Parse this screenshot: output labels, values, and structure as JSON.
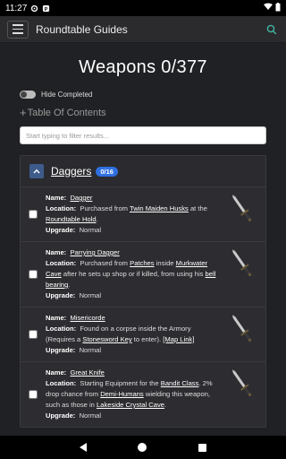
{
  "status_bar": {
    "time": "11:27"
  },
  "app_bar": {
    "title": "Roundtable Guides"
  },
  "page": {
    "title": "Weapons 0/377",
    "hide_completed_label": "Hide Completed",
    "toc_label": "Table Of Contents",
    "filter_placeholder": "Start typing to filter results..."
  },
  "section": {
    "title": "Daggers",
    "count": "0/16",
    "items": [
      {
        "name_label": "Name:",
        "name": "Dagger",
        "location_label": "Location:",
        "location": [
          {
            "t": "Purchased from "
          },
          {
            "t": "Twin Maiden Husks",
            "u": true
          },
          {
            "t": " at the "
          },
          {
            "t": "Roundtable Hold",
            "u": true
          },
          {
            "t": "."
          }
        ],
        "upgrade_label": "Upgrade:",
        "upgrade": "Normal"
      },
      {
        "name_label": "Name:",
        "name": "Parrying Dagger",
        "location_label": "Location:",
        "location": [
          {
            "t": "Purchased from "
          },
          {
            "t": "Patches",
            "u": true
          },
          {
            "t": " inside "
          },
          {
            "t": "Murkwater Cave",
            "u": true
          },
          {
            "t": " after he sets up shop or if killed, from using his "
          },
          {
            "t": "bell bearing",
            "u": true
          },
          {
            "t": "."
          }
        ],
        "upgrade_label": "Upgrade:",
        "upgrade": "Normal"
      },
      {
        "name_label": "Name:",
        "name": "Misericorde",
        "location_label": "Location:",
        "location": [
          {
            "t": "Found on a corpse inside the Armory (Requires a "
          },
          {
            "t": "Stonesword Key",
            "u": true
          },
          {
            "t": " to enter). "
          },
          {
            "t": "[Map Link]",
            "u": true
          }
        ],
        "upgrade_label": "Upgrade:",
        "upgrade": "Normal"
      },
      {
        "name_label": "Name:",
        "name": "Great Knife",
        "location_label": "Location:",
        "location": [
          {
            "t": "Starting Equipment for the "
          },
          {
            "t": "Bandit Class",
            "u": true
          },
          {
            "t": ". 2% drop chance from "
          },
          {
            "t": "Demi-Humans",
            "u": true
          },
          {
            "t": " wielding this weapon, such as those in "
          },
          {
            "t": "Lakeside Crystal Cave",
            "u": true
          },
          {
            "t": "."
          }
        ],
        "upgrade_label": "Upgrade:",
        "upgrade": "Normal"
      }
    ]
  },
  "colors": {
    "accent": "#2f6fe0",
    "search_icon": "#3fb6a0",
    "background": "#202124"
  },
  "icons": [
    "menu-icon",
    "search-icon",
    "chevron-up-icon",
    "dagger-icon",
    "back-icon",
    "home-icon",
    "recents-icon"
  ]
}
